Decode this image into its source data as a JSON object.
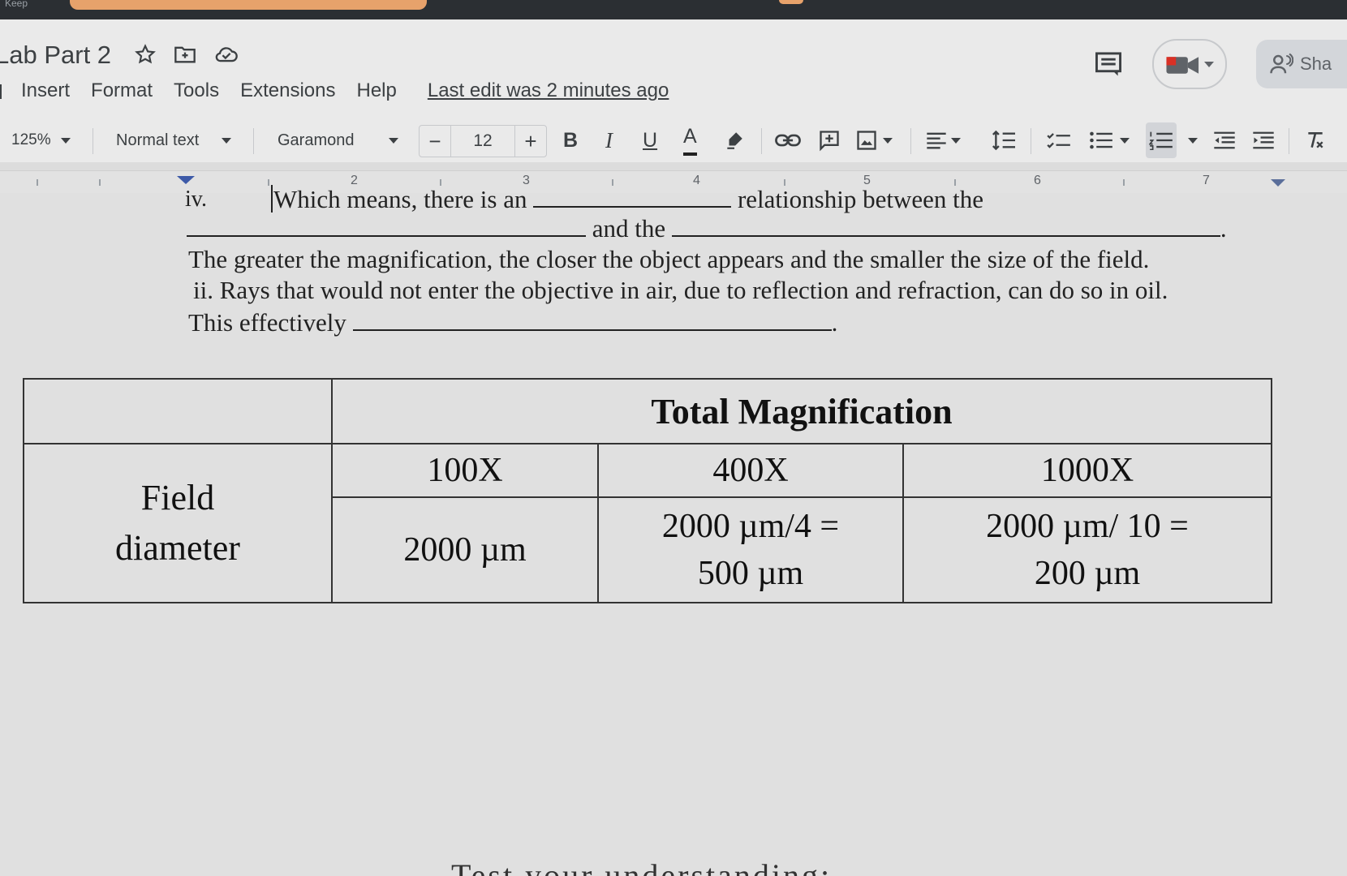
{
  "tab": {
    "label": "Keep"
  },
  "document": {
    "title": "Lab Part 2"
  },
  "title_icons": [
    "star-icon",
    "move-to-folder-icon",
    "cloud-status-icon"
  ],
  "menu": {
    "items": [
      "Insert",
      "Format",
      "Tools",
      "Extensions",
      "Help"
    ],
    "last_edit": "Last edit was 2 minutes ago"
  },
  "header_actions": {
    "share_label": "Sha"
  },
  "toolbar": {
    "zoom": "125%",
    "style": "Normal text",
    "font": "Garamond",
    "font_size": "12",
    "minus": "−",
    "plus": "+",
    "bold": "B",
    "italic": "I",
    "underline": "U",
    "text_color": "A"
  },
  "ruler": {
    "numbers": [
      "2",
      "3",
      "4",
      "5",
      "6",
      "7"
    ]
  },
  "body": {
    "line_iv_label": "iv.",
    "line_iv_text": "Which means, there is an",
    "line_iv_end": "relationship between the",
    "line2_and_the": "and the",
    "line2_period": ".",
    "sentence_greater": "The greater the magnification, the closer the object appears and the smaller the size of the field.",
    "sentence_rays": "ii. Rays that would not enter the objective in air, due to reflection and refraction, can do so in oil.",
    "this_effectively": "This effectively",
    "this_effectively_period": "."
  },
  "table": {
    "header": "Total Magnification",
    "columns": [
      "100X",
      "400X",
      "1000X"
    ],
    "row_label": [
      "Field",
      "diameter"
    ],
    "cells": [
      [
        "2000 µm"
      ],
      [
        "2000 µm/4 =",
        "500 µm"
      ],
      [
        "2000 µm/ 10 =",
        "200 µm"
      ]
    ]
  },
  "footer": {
    "text": "Test your understanding:"
  },
  "colors": {
    "accent": "#3d5aa8",
    "topbar": "#2b2f33",
    "tab_chip": "#e7a26b"
  }
}
